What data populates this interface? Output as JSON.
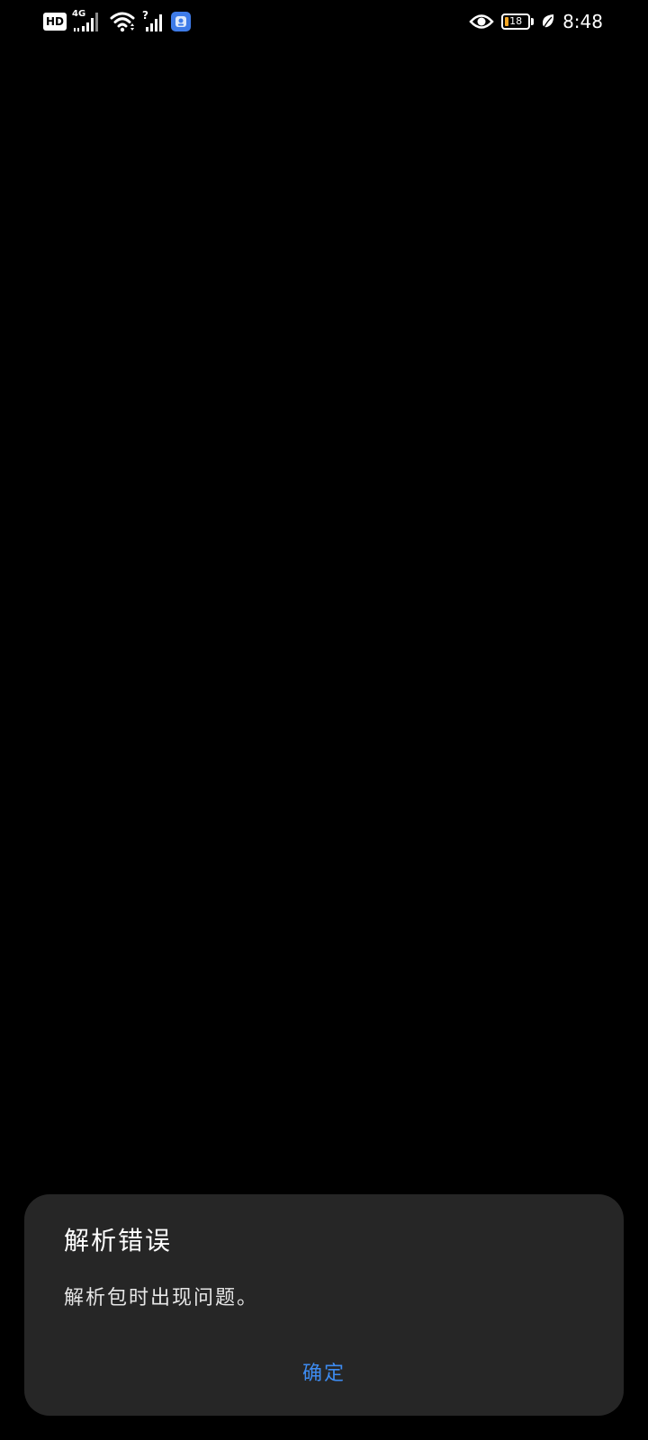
{
  "status_bar": {
    "hd_label": "HD",
    "network_type": "4G",
    "sim2_label": "?",
    "battery_level": 18,
    "battery_label": "18",
    "time": "8:48",
    "icons": [
      "hd-icon",
      "cellular-signal-icon",
      "wifi-icon",
      "cellular-signal-2-icon",
      "app-notification-icon",
      "eye-comfort-icon",
      "battery-icon",
      "power-saving-leaf-icon"
    ]
  },
  "dialog": {
    "title": "解析错误",
    "message": "解析包时出现问题。",
    "confirm_label": "确定"
  },
  "colors": {
    "background": "#000000",
    "dialog_background": "#262626",
    "accent": "#3d8bf0",
    "battery_fill": "#f5a623"
  }
}
